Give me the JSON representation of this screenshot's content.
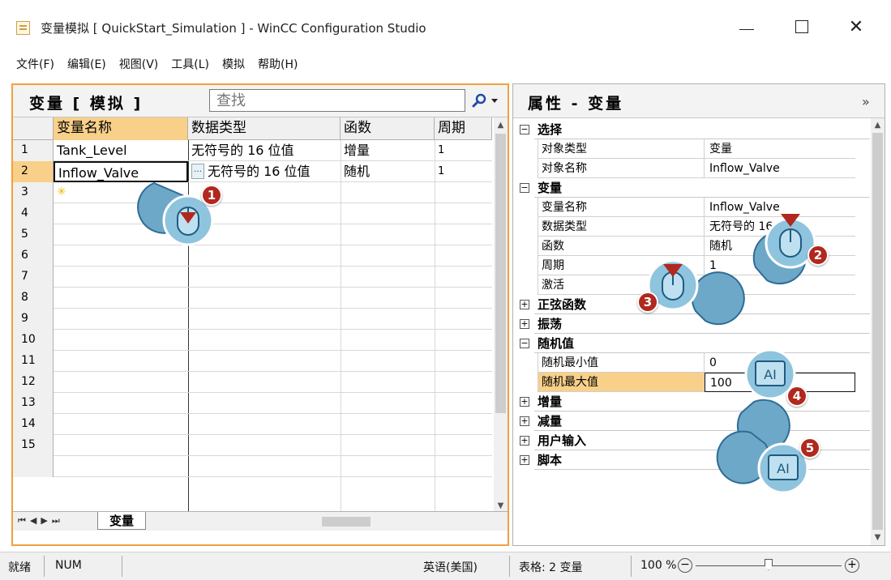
{
  "window": {
    "title": "变量模拟 [ QuickStart_Simulation ] - WinCC Configuration Studio"
  },
  "menu": [
    "文件(F)",
    "编辑(E)",
    "视图(V)",
    "工具(L)",
    "模拟",
    "帮助(H)"
  ],
  "left_pane": {
    "title": "变量 [ 模拟 ]",
    "search_placeholder": "查找",
    "columns": [
      "变量名称",
      "数据类型",
      "函数",
      "周期"
    ],
    "rows": [
      {
        "num": "1",
        "name": "Tank_Level",
        "type": "无符号的 16 位值",
        "func": "增量",
        "period": "1"
      },
      {
        "num": "2",
        "name": "Inflow_Valve",
        "type": "无符号的 16 位值",
        "func": "随机",
        "period": "1"
      }
    ],
    "row_numbers": [
      "3",
      "4",
      "5",
      "6",
      "7",
      "8",
      "9",
      "10",
      "11",
      "12",
      "13",
      "14",
      "15"
    ],
    "sheet_tab": "变量"
  },
  "right_pane": {
    "title": "属性 - 变量",
    "groups": {
      "selection": {
        "label": "选择",
        "object_type_label": "对象类型",
        "object_type_value": "变量",
        "object_name_label": "对象名称",
        "object_name_value": "Inflow_Valve"
      },
      "variable": {
        "label": "变量",
        "var_name_label": "变量名称",
        "var_name_value": "Inflow_Valve",
        "data_type_label": "数据类型",
        "data_type_value": "无符号的 16 位值",
        "function_label": "函数",
        "function_value": "随机",
        "period_label": "周期",
        "period_value": "1",
        "active_label": "激活",
        "active_checked": true
      },
      "sine": {
        "label": "正弦函数"
      },
      "oscillation": {
        "label": "振荡"
      },
      "random": {
        "label": "随机值",
        "min_label": "随机最小值",
        "min_value": "0",
        "max_label": "随机最大值",
        "max_value": "100"
      },
      "increment": {
        "label": "增量"
      },
      "decrement": {
        "label": "减量"
      },
      "user_input": {
        "label": "用户输入"
      },
      "script": {
        "label": "脚本"
      }
    }
  },
  "status": {
    "ready": "就绪",
    "num": "NUM",
    "language": "英语(美国)",
    "table_info": "表格: 2 变量",
    "zoom": "100 %"
  },
  "callouts": [
    "1",
    "2",
    "3",
    "4",
    "5"
  ],
  "colors": {
    "accent": "#f0a040",
    "selected": "#f8d089",
    "callout_badge": "#b0281e",
    "callout_bubble": "#6ea8c8"
  }
}
